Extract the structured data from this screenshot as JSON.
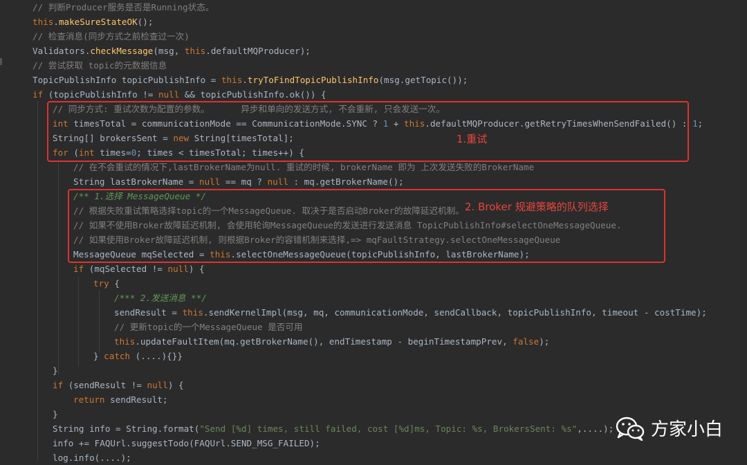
{
  "code_lines": [
    [
      "// 判断Producer服务是否是Running状态。"
    ],
    [
      "this.makeSureStateOK();"
    ],
    [
      "// 检查消息(同步方式之前检查过一次)"
    ],
    [
      "Validators.checkMessage(msg, this.defaultMQProducer);"
    ],
    [
      "// 尝试获取 topic的元数据信息"
    ],
    [
      "TopicPublishInfo topicPublishInfo = this.tryToFindTopicPublishInfo(msg.getTopic());"
    ],
    [
      "if (topicPublishInfo != null && topicPublishInfo.ok()) {"
    ],
    [
      "// 同步方式: 重试次数为配置的参数。      异步和单向的发送方式, 不会重新, 只会发送一次。"
    ],
    [
      "int timesTotal = communicationMode == CommunicationMode.SYNC ? 1 + this.defaultMQProducer.getRetryTimesWhenSendFailed() : 1;"
    ],
    [
      "String[] brokersSent = new String[timesTotal];"
    ],
    [
      "for (int times=0; times < timesTotal; times++) {"
    ],
    [
      "// 在不会重试的情况下,lastBrokerName为null. 重试的时候, brokerName 即为 上次发送失败的BrokerName"
    ],
    [
      "String lastBrokerName = null == mq ? null : mq.getBrokerName();"
    ],
    [
      "/** 1.选择 MessageQueue */"
    ],
    [
      "// 根据失败重试策略选择topic的一个MessageQueue. 取决于是否启动Broker的故障延迟机制。"
    ],
    [
      "// 如果不使用Broker故障延迟机制, 会使用轮询MessageQueue的发送进行发送消息 TopicPublishInfo#selectOneMessageQueue."
    ],
    [
      "// 如果使用Broker故障延迟机制, 则根据Broker的容错机制来选择,=> mqFaultStrategy.selectOneMessageQueue"
    ],
    [
      "MessageQueue mqSelected = this.selectOneMessageQueue(topicPublishInfo, lastBrokerName);"
    ],
    [
      "if (mqSelected != null) {"
    ],
    [
      "try {"
    ],
    [
      "/*** 2.发送消息 **/"
    ],
    [
      "sendResult = this.sendKernelImpl(msg, mq, communicationMode, sendCallback, topicPublishInfo, timeout - costTime);"
    ],
    [
      "// 更新topic的一个MessageQueue 是否可用"
    ],
    [
      "this.updateFaultItem(mq.getBrokerName(), endTimestamp - beginTimestampPrev, false);"
    ],
    [
      "} catch (....){}}"
    ],
    [
      "}"
    ],
    [
      "if (sendResult != null) {"
    ],
    [
      "return sendResult;"
    ],
    [
      "}"
    ],
    [
      "String info = String.format(\"Send [%d] times, still failed, cost [%d]ms, Topic: %s, BrokersSent: %s\",....);"
    ],
    [
      "info += FAQUrl.suggestTodo(FAQUrl.SEND_MSG_FAILED);"
    ],
    [
      "log.info(....);"
    ]
  ],
  "annotations": {
    "retry": "1.重试",
    "broker_strategy": "2. Broker 规避策略的队列选择"
  },
  "watermark": {
    "icon": "wechat-icon",
    "text": "方家小白"
  },
  "colors": {
    "background": "#2b2b2b",
    "keyword": "#cc7832",
    "comment": "#808080",
    "method": "#ffc66d",
    "number": "#6897bb",
    "string": "#6a8759",
    "doc_comment": "#629755",
    "text": "#a9b7c6",
    "highlight_box": "#e0312f"
  }
}
